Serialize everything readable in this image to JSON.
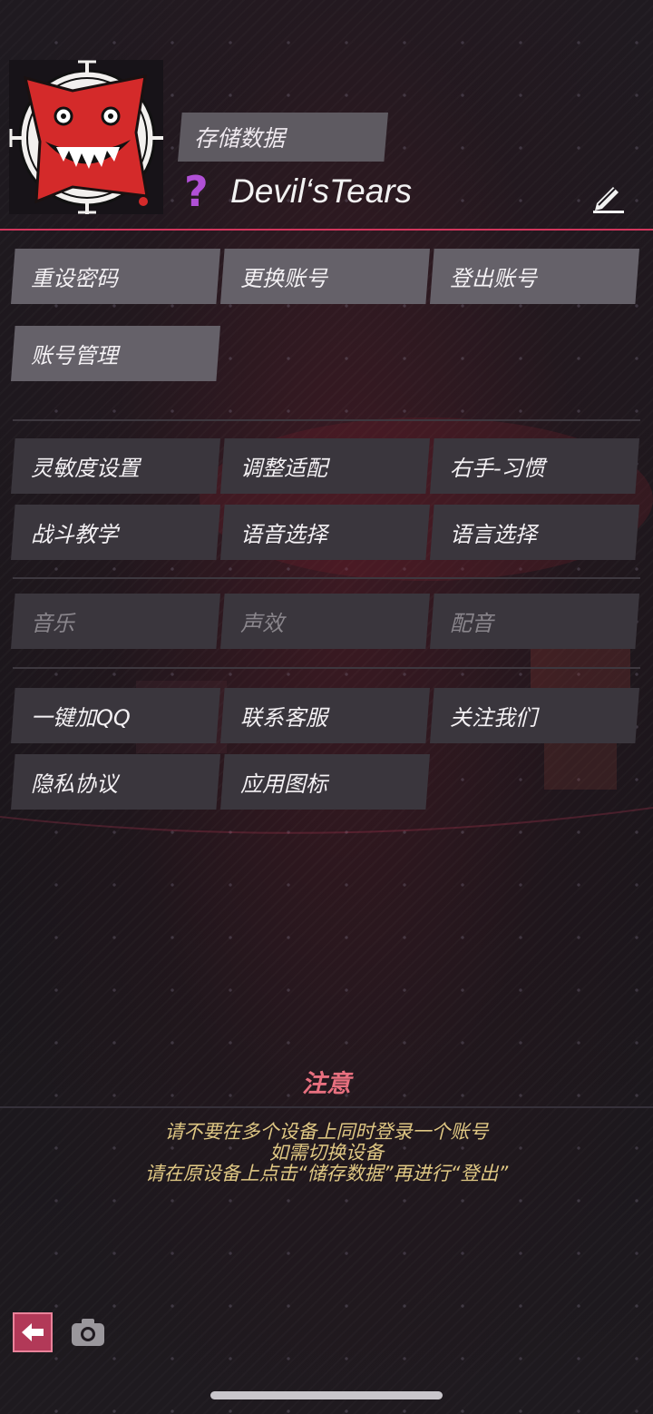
{
  "profile": {
    "save_label": "存储数据",
    "rank_symbol": "?",
    "username": "Devil‘sTears"
  },
  "account_buttons": [
    {
      "label": "重设密码"
    },
    {
      "label": "更换账号"
    },
    {
      "label": "登出账号"
    },
    {
      "label": "账号管理"
    }
  ],
  "settings_buttons": [
    {
      "label": "灵敏度设置"
    },
    {
      "label": "调整适配"
    },
    {
      "label": "右手-习惯"
    },
    {
      "label": "战斗教学"
    },
    {
      "label": "语音选择"
    },
    {
      "label": "语言选择"
    }
  ],
  "audio_buttons": [
    {
      "label": "音乐"
    },
    {
      "label": "声效"
    },
    {
      "label": "配音"
    }
  ],
  "social_buttons": [
    {
      "label": "一键加QQ"
    },
    {
      "label": "联系客服"
    },
    {
      "label": "关注我们"
    },
    {
      "label": "隐私协议"
    },
    {
      "label": "应用图标"
    }
  ],
  "notice": {
    "title": "注意",
    "lines": [
      "请不要在多个设备上同时登录一个账号",
      "如需切换设备",
      "请在原设备上点击“储存数据”再进行“登出”"
    ]
  },
  "colors": {
    "accent": "#d0365c",
    "notice_title": "#e8707f",
    "notice_text": "#e0c884",
    "rank": "#b150d6"
  },
  "icons": {
    "edit": "pencil-icon",
    "back": "back-arrow-icon",
    "camera": "camera-icon"
  }
}
